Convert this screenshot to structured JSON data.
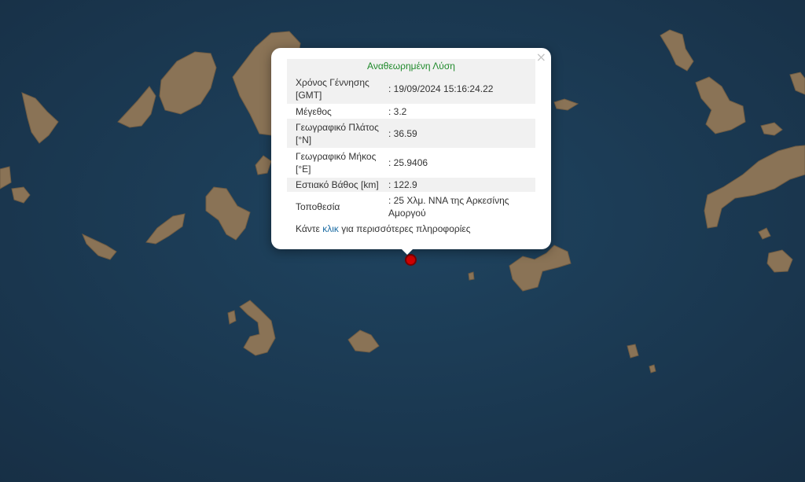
{
  "popup": {
    "title": "Αναθεωρημένη Λύση",
    "close": "×",
    "rows": [
      {
        "label": "Χρόνος Γέννησης [GMT]",
        "value": ": 19/09/2024 15:16:24.22"
      },
      {
        "label": "Μέγεθος",
        "value": ": 3.2"
      },
      {
        "label": "Γεωγραφικό Πλάτος [°N]",
        "value": ": 36.59"
      },
      {
        "label": "Γεωγραφικό Μήκος [°E]",
        "value": ": 25.9406"
      },
      {
        "label": "Εστιακό Βάθος [km]",
        "value": ": 122.9"
      },
      {
        "label": "Τοποθεσία",
        "value": ": 25 Χλμ. ΝΝΑ της Αρκεσίνης Αμοργού"
      }
    ],
    "more_prefix": "Κάντε ",
    "more_link": "κλικ",
    "more_suffix": " για περισσότερες πληροφορίες"
  },
  "map": {
    "sea_color": "#1c3b55",
    "land_color": "#8a7356",
    "marker_color": "#d00000"
  }
}
